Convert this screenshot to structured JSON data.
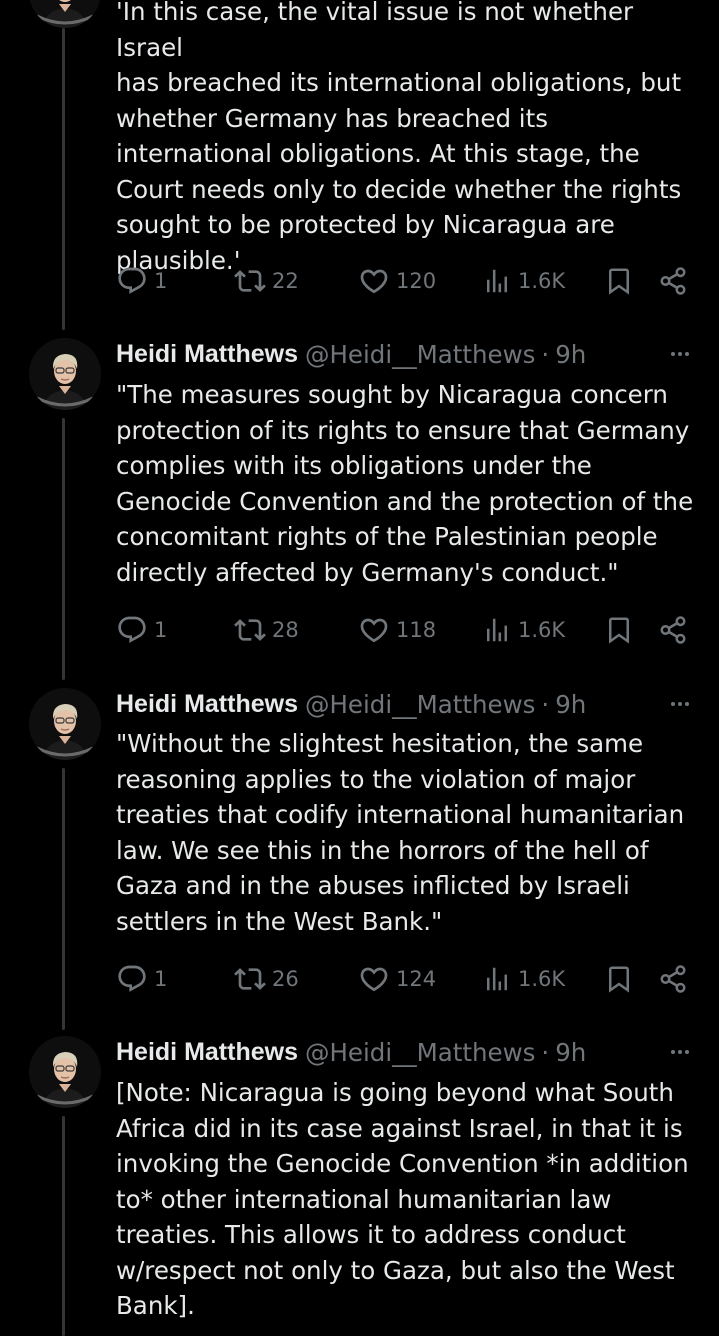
{
  "colors": {
    "background": "#000000",
    "text": "#e7e9ea",
    "secondary": "#71767b",
    "thread_line": "#333639"
  },
  "icons": {
    "reply": "speech-bubble-icon",
    "repost": "repost-arrows-icon",
    "like": "heart-icon",
    "views": "bar-chart-icon",
    "bookmark": "bookmark-icon",
    "share": "share-icon",
    "more": "more-dots-icon"
  },
  "tweets": [
    {
      "text": "'In this case, the vital issue is not whether Israel\nhas breached its international obligations, but\nwhether Germany has breached its\ninternational obligations. At this stage, the\nCourt needs only to decide whether the rights\nsought to be protected by Nicaragua are\nplausible.'",
      "replies": "1",
      "reposts": "22",
      "likes": "120",
      "views": "1.6K"
    },
    {
      "author": "Heidi Matthews",
      "handle": "@Heidi__Matthews",
      "separator": "·",
      "time": "9h",
      "text": "\"The measures sought by Nicaragua concern\nprotection of its rights to ensure that Germany\ncomplies with its obligations under the\nGenocide Convention and the protection of the\nconcomitant rights of the Palestinian people\ndirectly affected by Germany's conduct.\"",
      "replies": "1",
      "reposts": "28",
      "likes": "118",
      "views": "1.6K"
    },
    {
      "author": "Heidi Matthews",
      "handle": "@Heidi__Matthews",
      "separator": "·",
      "time": "9h",
      "text": "\"Without the slightest hesitation, the same\nreasoning applies to the violation of major\ntreaties that codify international humanitarian\nlaw. We see this in the horrors of the hell of\nGaza and in the abuses inflicted by Israeli\nsettlers in the West Bank.\"",
      "replies": "1",
      "reposts": "26",
      "likes": "124",
      "views": "1.6K"
    },
    {
      "author": "Heidi Matthews",
      "handle": "@Heidi__Matthews",
      "separator": "·",
      "time": "9h",
      "text": "[Note: Nicaragua is going beyond what South\nAfrica did in its case against Israel, in that it is\ninvoking the Genocide Convention *in addition\nto* other international humanitarian law\ntreaties. This allows it to address conduct\nw/respect not only to Gaza, but also the West\nBank]."
    }
  ]
}
